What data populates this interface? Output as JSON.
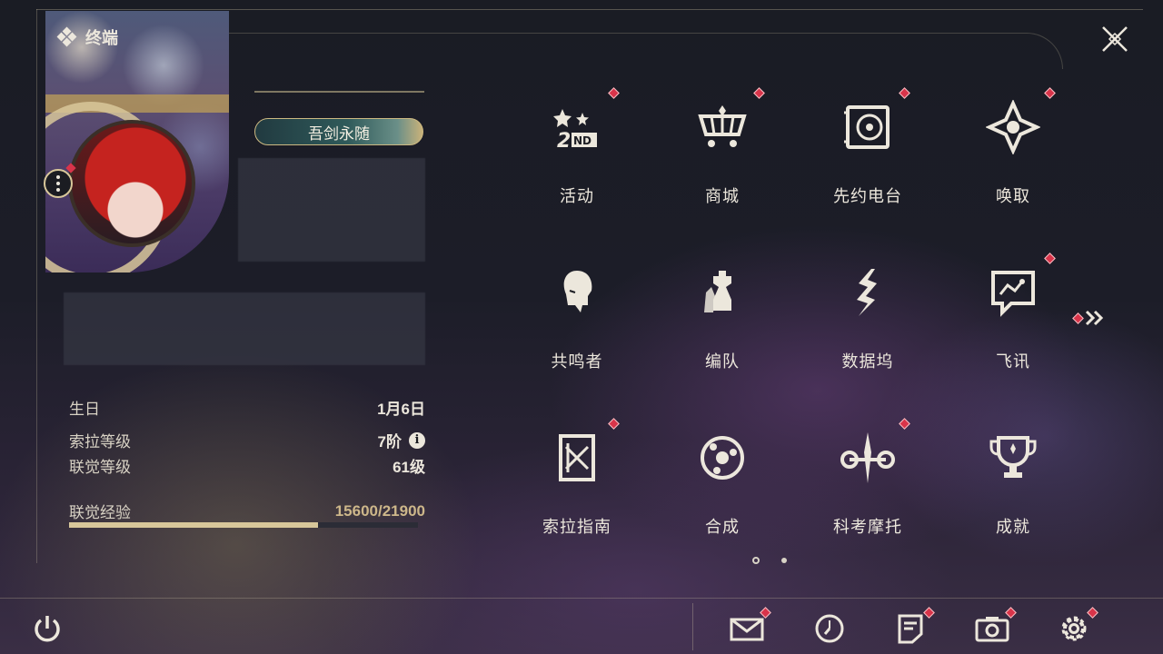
{
  "header": {
    "terminal_label": "终端"
  },
  "profile": {
    "title_badge": "吾剑永随"
  },
  "stats": [
    {
      "label": "生日",
      "value": "1月6日"
    },
    {
      "label": "索拉等级",
      "value": "7阶"
    },
    {
      "label": "联觉等级",
      "value": "61级"
    }
  ],
  "experience": {
    "label": "联觉经验",
    "value": "15600/21900",
    "current": 15600,
    "max": 21900
  },
  "menu": [
    {
      "label": "活动",
      "icon": "event-2nd-anniversary-icon",
      "badge": true
    },
    {
      "label": "商城",
      "icon": "shop-cart-icon",
      "badge": true
    },
    {
      "label": "先约电台",
      "icon": "radio-icon",
      "badge": true
    },
    {
      "label": "唤取",
      "icon": "convene-icon",
      "badge": true
    },
    {
      "label": "共鸣者",
      "icon": "resonator-icon",
      "badge": false
    },
    {
      "label": "编队",
      "icon": "team-icon",
      "badge": false
    },
    {
      "label": "数据坞",
      "icon": "data-bank-icon",
      "badge": false
    },
    {
      "label": "飞讯",
      "icon": "messages-icon",
      "badge": true
    },
    {
      "label": "索拉指南",
      "icon": "guidebook-icon",
      "badge": true
    },
    {
      "label": "合成",
      "icon": "synthesis-icon",
      "badge": false
    },
    {
      "label": "科考摩托",
      "icon": "motorbike-icon",
      "badge": true
    },
    {
      "label": "成就",
      "icon": "achievement-trophy-icon",
      "badge": false
    }
  ],
  "pagination": {
    "pages": 2,
    "current": 1
  },
  "bottom_bar": {
    "items": [
      {
        "icon": "mail-icon",
        "badge": true
      },
      {
        "icon": "clock-icon",
        "badge": false
      },
      {
        "icon": "notes-icon",
        "badge": true
      },
      {
        "icon": "camera-icon",
        "badge": true
      },
      {
        "icon": "settings-gear-icon",
        "badge": true
      }
    ]
  },
  "colors": {
    "accent_gold": "#d8c79a",
    "badge_red": "#d9344a",
    "text": "#ece7dc"
  }
}
